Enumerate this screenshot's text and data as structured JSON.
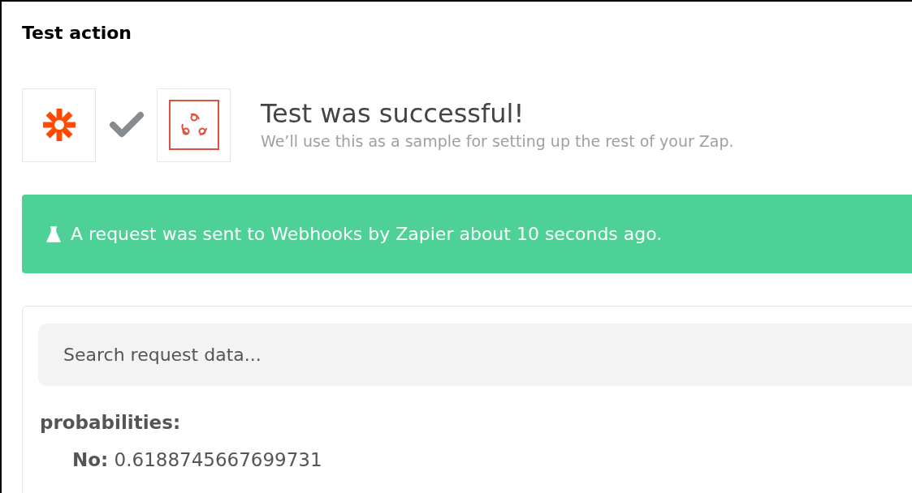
{
  "section_title": "Test action",
  "result": {
    "title": "Test was successful!",
    "subtitle": "We’ll use this as a sample for setting up the rest of your Zap.",
    "success": true
  },
  "banner": {
    "text": "A request was sent to Webhooks by Zapier about 10 seconds ago."
  },
  "search": {
    "placeholder": "Search request data..."
  },
  "data": [
    {
      "key": "probabilities:",
      "children": [
        {
          "key": "No:",
          "value": "0.6188745667699731"
        }
      ]
    }
  ]
}
